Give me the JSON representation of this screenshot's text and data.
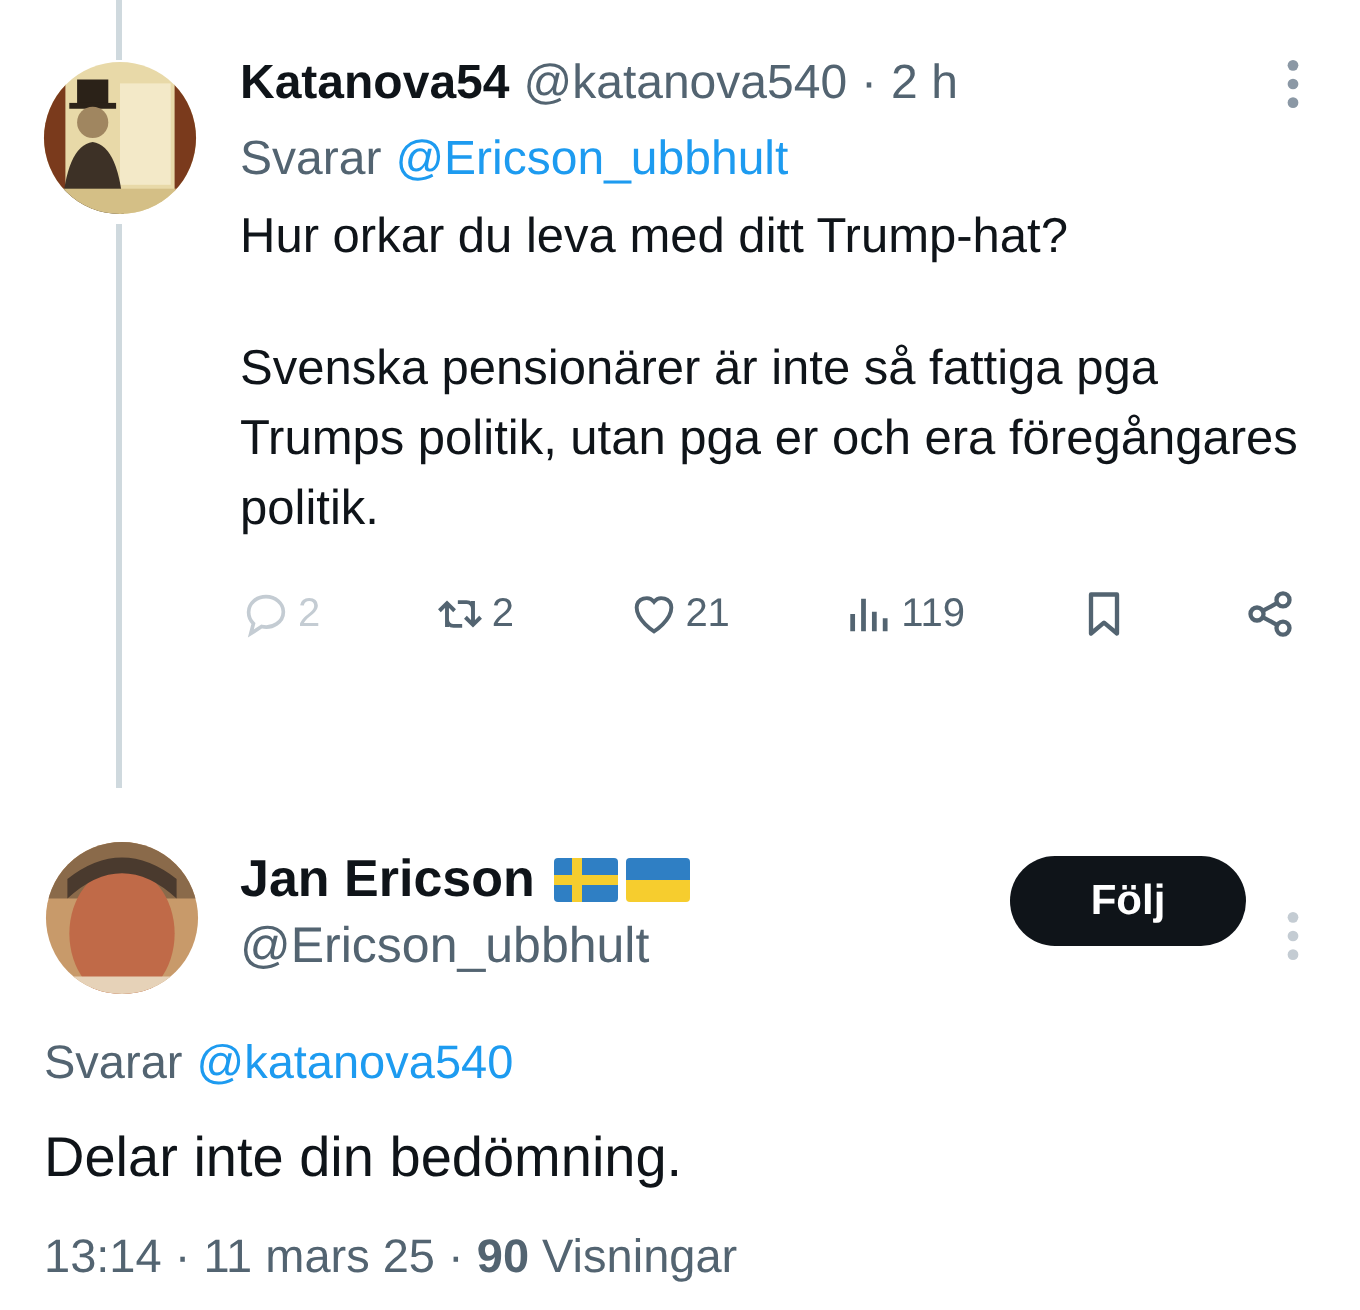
{
  "reply": {
    "author_name": "Katanova54",
    "handle": "@katanova540",
    "separator": "·",
    "time": "2 h",
    "replying_to_label": "Svarar",
    "replying_to_handle": "@Ericson_ubbhult",
    "paragraphs": [
      "Hur orkar du leva med ditt Trump-hat?",
      "Svenska pensionärer är inte så fattiga pga Trumps politik, utan pga er och era föregångares politik."
    ],
    "actions": [
      {
        "kind": "reply",
        "count": "2",
        "disabled": true
      },
      {
        "kind": "repost",
        "count": "2",
        "disabled": false
      },
      {
        "kind": "like",
        "count": "21",
        "disabled": false
      },
      {
        "kind": "views",
        "count": "119",
        "disabled": false
      },
      {
        "kind": "bookmark",
        "disabled": false
      },
      {
        "kind": "share",
        "disabled": false
      }
    ]
  },
  "main_tweet": {
    "author_name": "Jan Ericson",
    "flags": [
      {
        "kind": "sweden"
      },
      {
        "kind": "ukraine"
      }
    ],
    "handle": "@Ericson_ubbhult",
    "follow_button": "Följ",
    "replying_to_label": "Svarar",
    "replying_to_handle": "@katanova540",
    "text": "Delar inte din bedömning.",
    "meta": "13:14 · 11 mars 25 · **90** Visningar"
  }
}
